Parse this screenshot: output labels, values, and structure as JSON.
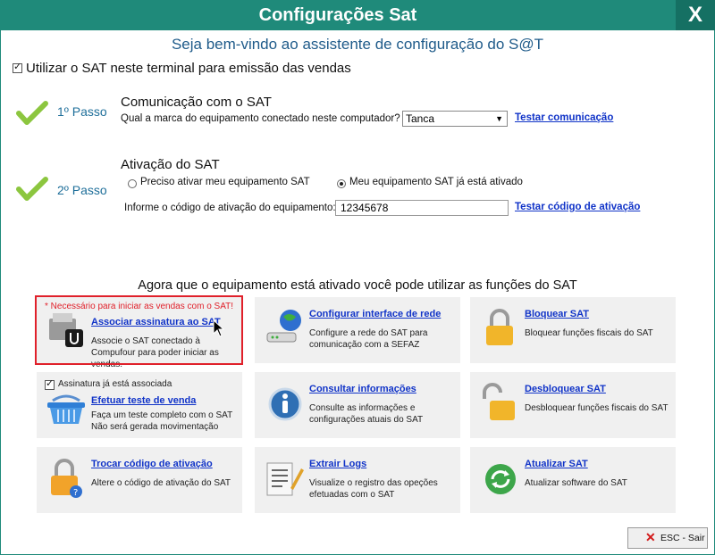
{
  "window": {
    "title": "Configurações Sat",
    "close_label": "X"
  },
  "welcome": "Seja bem-vindo ao assistente de configuração do S@T",
  "use_sat": {
    "checked": true,
    "label": "Utilizar o SAT neste terminal para emissão das vendas"
  },
  "step1": {
    "step_label": "1º Passo",
    "title": "Comunicação com o SAT",
    "question": "Qual a marca do equipamento conectado neste computador?",
    "brand_selected": "Tanca",
    "test_link": "Testar comunicação"
  },
  "step2": {
    "step_label": "2º Passo",
    "title": "Ativação do SAT",
    "radio_need_activate": "Preciso ativar meu equipamento SAT",
    "radio_already_active": "Meu equipamento SAT já está ativado",
    "selected": "already_active",
    "code_label": "Informe o código de ativação do equipamento:",
    "code_value": "12345678",
    "test_code_link": "Testar código de ativação"
  },
  "functions_header": "Agora que o equipamento está ativado você pode utilizar as funções do SAT",
  "tiles": {
    "associar": {
      "note": "* Necessário para iniciar as vendas com o SAT!",
      "title": "Associar assinatura ao SAT",
      "desc": "Associe o SAT conectado à Compufour para poder iniciar as vendas."
    },
    "rede": {
      "title": "Configurar interface de rede",
      "desc": "Configure a rede do SAT para comunicação com a SEFAZ"
    },
    "bloquear": {
      "title": "Bloquear SAT",
      "desc": "Bloquear funções fiscais do SAT"
    },
    "teste": {
      "assoc_checkbox": "Assinatura já está associada",
      "title": "Efetuar teste de venda",
      "desc": "Faça um teste completo com o SAT Não será gerada movimentação"
    },
    "consultar": {
      "title": "Consultar informações",
      "desc": "Consulte as informações e configurações atuais do SAT"
    },
    "desbloquear": {
      "title": "Desbloquear SAT",
      "desc": "Desbloquear funções fiscais do SAT"
    },
    "trocar": {
      "title": "Trocar código de ativação",
      "desc": "Altere o código de ativação do SAT"
    },
    "logs": {
      "title": "Extrair Logs",
      "desc": "Visualize o registro das opeções efetuadas com o SAT"
    },
    "atualizar": {
      "title": "Atualizar SAT",
      "desc": "Atualizar software do SAT"
    }
  },
  "esc_button": "ESC - Sair",
  "colors": {
    "titlebar": "#1f8a7a",
    "link": "#1033c8",
    "highlight": "#e0202a",
    "check_green": "#8cc63f"
  }
}
